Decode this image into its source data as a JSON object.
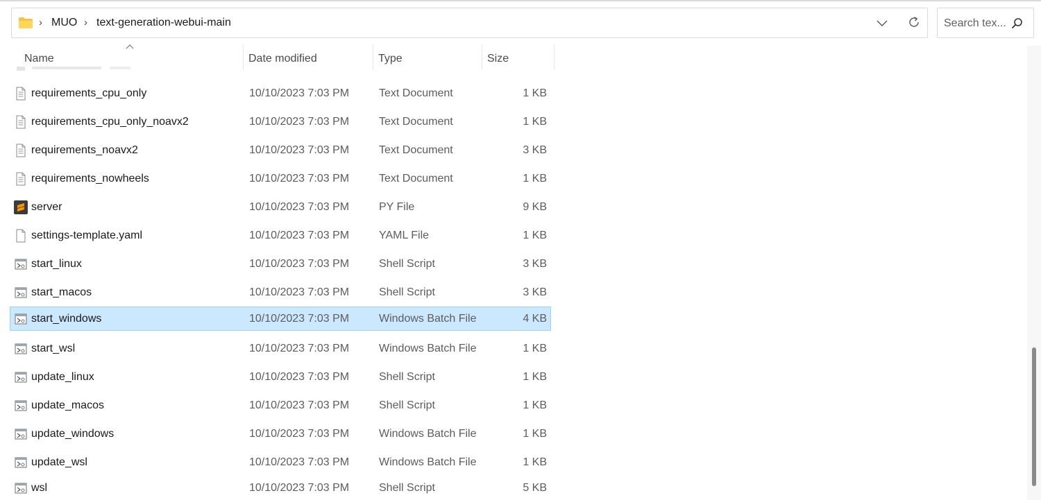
{
  "address": {
    "breadcrumbs": [
      "MUO",
      "text-generation-webui-main"
    ],
    "icons": {
      "folder": "folder-icon",
      "dropdown": "chevron-down-icon",
      "refresh": "refresh-icon"
    }
  },
  "search": {
    "placeholder": "Search tex...",
    "icon": "search-icon"
  },
  "columns": {
    "name": "Name",
    "date": "Date modified",
    "type": "Type",
    "size": "Size"
  },
  "files": [
    {
      "name": "requirements_cpu_only",
      "date": "10/10/2023 7:03 PM",
      "type": "Text Document",
      "size": "1 KB",
      "icon": "text-file-icon"
    },
    {
      "name": "requirements_cpu_only_noavx2",
      "date": "10/10/2023 7:03 PM",
      "type": "Text Document",
      "size": "1 KB",
      "icon": "text-file-icon"
    },
    {
      "name": "requirements_noavx2",
      "date": "10/10/2023 7:03 PM",
      "type": "Text Document",
      "size": "3 KB",
      "icon": "text-file-icon"
    },
    {
      "name": "requirements_nowheels",
      "date": "10/10/2023 7:03 PM",
      "type": "Text Document",
      "size": "1 KB",
      "icon": "text-file-icon"
    },
    {
      "name": "server",
      "date": "10/10/2023 7:03 PM",
      "type": "PY File",
      "size": "9 KB",
      "icon": "sublime-text-icon"
    },
    {
      "name": "settings-template.yaml",
      "date": "10/10/2023 7:03 PM",
      "type": "YAML File",
      "size": "1 KB",
      "icon": "blank-file-icon"
    },
    {
      "name": "start_linux",
      "date": "10/10/2023 7:03 PM",
      "type": "Shell Script",
      "size": "3 KB",
      "icon": "script-file-icon"
    },
    {
      "name": "start_macos",
      "date": "10/10/2023 7:03 PM",
      "type": "Shell Script",
      "size": "3 KB",
      "icon": "script-file-icon"
    },
    {
      "name": "start_windows",
      "date": "10/10/2023 7:03 PM",
      "type": "Windows Batch File",
      "size": "4 KB",
      "icon": "script-file-icon",
      "selected": true
    },
    {
      "name": "start_wsl",
      "date": "10/10/2023 7:03 PM",
      "type": "Windows Batch File",
      "size": "1 KB",
      "icon": "script-file-icon"
    },
    {
      "name": "update_linux",
      "date": "10/10/2023 7:03 PM",
      "type": "Shell Script",
      "size": "1 KB",
      "icon": "script-file-icon"
    },
    {
      "name": "update_macos",
      "date": "10/10/2023 7:03 PM",
      "type": "Shell Script",
      "size": "1 KB",
      "icon": "script-file-icon"
    },
    {
      "name": "update_windows",
      "date": "10/10/2023 7:03 PM",
      "type": "Windows Batch File",
      "size": "1 KB",
      "icon": "script-file-icon"
    },
    {
      "name": "update_wsl",
      "date": "10/10/2023 7:03 PM",
      "type": "Windows Batch File",
      "size": "1 KB",
      "icon": "script-file-icon"
    },
    {
      "name": "wsl",
      "date": "10/10/2023 7:03 PM",
      "type": "Shell Script",
      "size": "5 KB",
      "icon": "script-file-icon"
    }
  ],
  "colors": {
    "selection_bg": "#cce8ff",
    "selection_border": "#99d1ff",
    "folder": "#f4c542"
  }
}
